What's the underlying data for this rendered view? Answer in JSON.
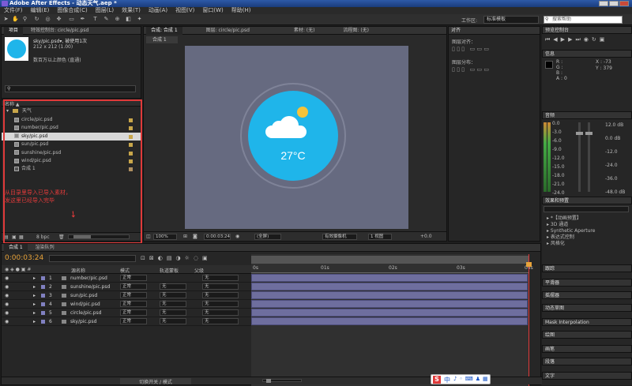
{
  "window": {
    "title": "Adobe After Effects - 动态天气.aep *"
  },
  "menu": [
    "文件(F)",
    "编辑(E)",
    "图像合成(C)",
    "图层(L)",
    "效果(T)",
    "动画(A)",
    "视图(V)",
    "窗口(W)",
    "帮助(H)"
  ],
  "toolbar": {
    "workspace_label": "工作区:",
    "workspace_value": "标准模板",
    "search_placeholder": "搜索帮助"
  },
  "project": {
    "tabs": [
      "项目",
      "特效控制台: circle/pic.psd"
    ],
    "selected_name": "sky/pic.psd▾, 被使用1次",
    "selected_size": "212 x 212 (1.00)",
    "selected_desc": "数百万以上颜色 (直通)",
    "folder": "天气",
    "items": [
      "circle/pic.psd",
      "number/pic.psd",
      "sky/pic.psd",
      "sun/pic.psd",
      "sunshine/pic.psd",
      "wind/pic.psd",
      "合成 1"
    ],
    "annotation": "从目录里导入已导入素材，\n发这里已经导入完毕",
    "bpc": "8 bpc"
  },
  "composition": {
    "tabs": [
      "合成: 合成 1",
      "图层: circle/pic.psd",
      "素材: (无)",
      "流程图: (无)"
    ],
    "subtab": "合成 1",
    "temperature": "27°C",
    "zoom": "100%",
    "time": "0:00:03:24",
    "res": "(全屏)",
    "camera": "有效摄像机",
    "views": "1 视图",
    "offset": "+0.0"
  },
  "align": {
    "header": "对齐",
    "align_label": "图层对齐：",
    "distribute_label": "图层分布："
  },
  "preview": {
    "header": "预览控制台"
  },
  "info": {
    "header": "信息",
    "r": "R :",
    "g": "G :",
    "b": "B :",
    "a": "A : 0",
    "x": "X : -73",
    "y": "Y : 379"
  },
  "audio": {
    "header": "音频",
    "left_scale": [
      "0.0",
      "-3.0",
      "-6.0",
      "-9.0",
      "-12.0",
      "-15.0",
      "-18.0",
      "-21.0",
      "-24.0"
    ],
    "db_scale": [
      "12.0 dB",
      "0.0 dB",
      "-12.0",
      "-24.0",
      "-36.0",
      "-48.0 dB"
    ]
  },
  "effects": {
    "header": "效果和预置",
    "items": [
      "*【动画预置】",
      "3D 通道",
      "Synthetic Aperture",
      "表达式控制",
      "风格化"
    ]
  },
  "right_panels": [
    "跟踪",
    "平滑器",
    "摇摆器",
    "动态草图",
    "Mask Interpolation",
    "绘图",
    "画笔",
    "段落",
    "文字"
  ],
  "timeline": {
    "tabs": [
      "合成 1",
      "渲染队列"
    ],
    "time": "0:00:03:24",
    "col_source": "源名称",
    "col_mode": "模式",
    "col_trkmat": "轨道蒙板",
    "col_parent": "父级",
    "ruler": [
      "0s",
      "01s",
      "02s",
      "03s",
      "04s"
    ],
    "layers": [
      {
        "num": "1",
        "name": "number/pic.psd",
        "mode": "正常",
        "trk": "",
        "parent": "无"
      },
      {
        "num": "2",
        "name": "sunshine/pic.psd",
        "mode": "正常",
        "trk": "无",
        "parent": "无"
      },
      {
        "num": "3",
        "name": "sun/pic.psd",
        "mode": "正常",
        "trk": "无",
        "parent": "无"
      },
      {
        "num": "4",
        "name": "wind/pic.psd",
        "mode": "正常",
        "trk": "无",
        "parent": "无"
      },
      {
        "num": "5",
        "name": "circle/pic.psd",
        "mode": "正常",
        "trk": "无",
        "parent": "无"
      },
      {
        "num": "6",
        "name": "sky/pic.psd",
        "mode": "正常",
        "trk": "无",
        "parent": "无"
      }
    ],
    "toggle_label": "切换开关 / 模式"
  },
  "ime": {
    "label": "中"
  },
  "colors": {
    "accent_red": "#e03a3a",
    "sky_blue": "#1fb5ea",
    "comp_bg": "#666a80",
    "bar_purple": "#6e6e9e",
    "time_orange": "#e8a33a"
  }
}
